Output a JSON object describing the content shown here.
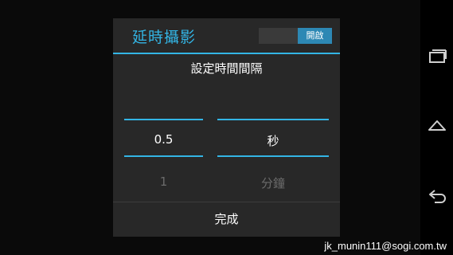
{
  "dialog": {
    "title": "延時攝影",
    "toggle_label": "開啟",
    "subtitle": "設定時間間隔",
    "value_picker": {
      "selected": "0.5",
      "next": "1"
    },
    "unit_picker": {
      "selected": "秒",
      "next": "分鐘"
    },
    "done_label": "完成"
  },
  "watermark": "jk_munin111@sogi.com.tw",
  "navigation": {
    "icons": [
      "recent-apps-icon",
      "home-icon",
      "back-icon"
    ]
  },
  "colors": {
    "accent": "#33b5e5",
    "dialog_bg": "#282828"
  }
}
